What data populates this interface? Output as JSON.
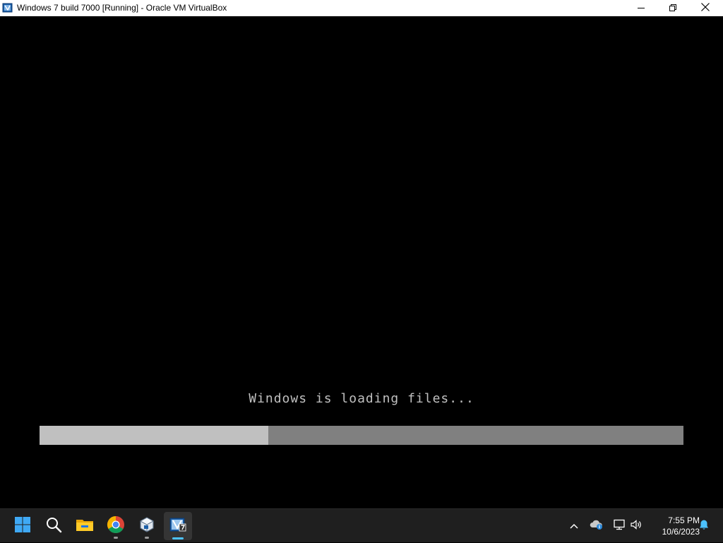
{
  "window": {
    "title": "Windows 7 build 7000 [Running] - Oracle VM VirtualBox",
    "icon": "virtualbox-vm-icon",
    "controls": [
      "minimize-icon",
      "restore-icon",
      "close-icon"
    ]
  },
  "vm": {
    "loading_text": "Windows is loading files...",
    "progress": 0.355,
    "colors": {
      "background": "#000000",
      "text": "#c0c0c0",
      "progress_fill": "#c0c0c0",
      "progress_track": "#808080"
    }
  },
  "taskbar": {
    "items": [
      {
        "name": "start-button",
        "icon": "windows-logo-icon"
      },
      {
        "name": "search-button",
        "icon": "search-icon"
      },
      {
        "name": "file-explorer",
        "icon": "folder-icon"
      },
      {
        "name": "chrome",
        "icon": "chrome-icon",
        "running": true
      },
      {
        "name": "virtualbox-manager",
        "icon": "virtualbox-icon",
        "running": true
      },
      {
        "name": "virtualbox-vm-window",
        "icon": "virtualbox-vm-icon",
        "active": true
      }
    ],
    "tray": {
      "icons": [
        "chevron-up-icon",
        "onedrive-icon",
        "network-icon",
        "volume-icon",
        "notification-bell-icon"
      ],
      "time": "7:55 PM",
      "date": "10/6/2023"
    },
    "colors": {
      "background": "#1f1f1f",
      "accent": "#4cc2ff"
    }
  }
}
